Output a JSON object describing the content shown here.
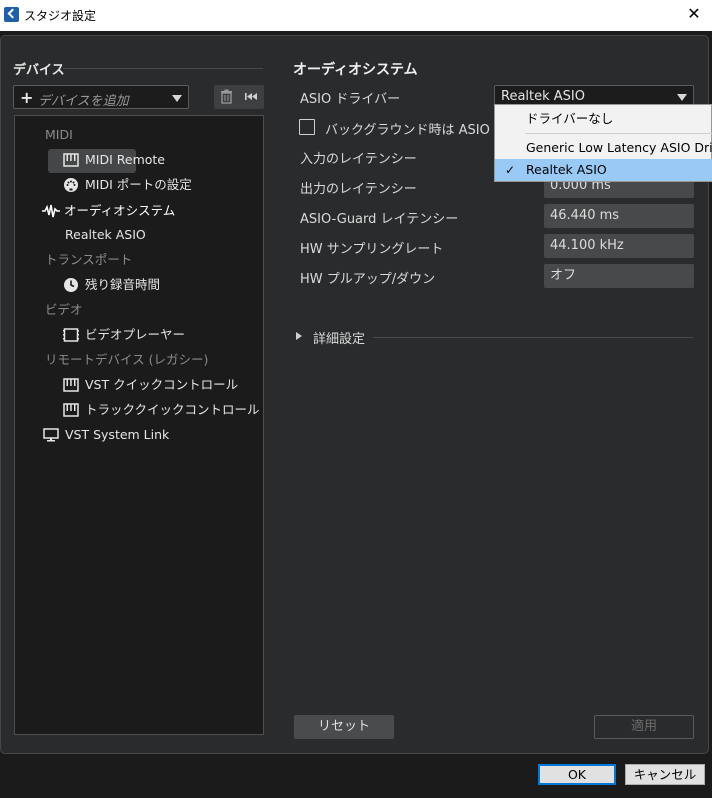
{
  "window": {
    "title": "スタジオ設定",
    "close": "✕"
  },
  "left": {
    "heading": "デバイス",
    "add_device": "デバイスを追加",
    "tree": {
      "midi": "MIDI",
      "midi_remote": "MIDI Remote",
      "midi_port": "MIDI ポートの設定",
      "audio_system": "オーディオシステム",
      "realtek": "Realtek ASIO",
      "transport": "トランスポート",
      "remaining_rec": "残り録音時間",
      "video": "ビデオ",
      "video_player": "ビデオプレーヤー",
      "remote_legacy": "リモートデバイス (レガシー)",
      "vst_quick": "VST クイックコントロール",
      "track_quick": "トラッククイックコントロール",
      "vst_link": "VST System Link"
    }
  },
  "right": {
    "heading": "オーディオシステム",
    "asio_driver_label": "ASIO ドライバー",
    "asio_driver_value": "Realtek ASIO",
    "background_label": "バックグラウンド時は ASIO ドライバ",
    "input_latency_label": "入力のレイテンシー",
    "output_latency_label": "出力のレイテンシー",
    "output_latency_value": "0.000 ms",
    "asio_guard_label": "ASIO-Guard レイテンシー",
    "asio_guard_value": "46.440 ms",
    "sample_rate_label": "HW サンプリングレート",
    "sample_rate_value": "44.100 kHz",
    "pullup_label": "HW プルアップ/ダウン",
    "pullup_value": "オフ",
    "details_label": "詳細設定",
    "reset": "リセット",
    "apply": "適用"
  },
  "dropdown": {
    "items": [
      "ドライバーなし",
      "Generic Low Latency ASIO Driver",
      "Realtek ASIO"
    ],
    "selected_index": 2,
    "check": "✓"
  },
  "footer": {
    "ok": "OK",
    "cancel": "キャンセル"
  },
  "colors": {
    "accent": "#0078d7",
    "selection": "#99c9f5",
    "panel": "#2a2b2d"
  }
}
